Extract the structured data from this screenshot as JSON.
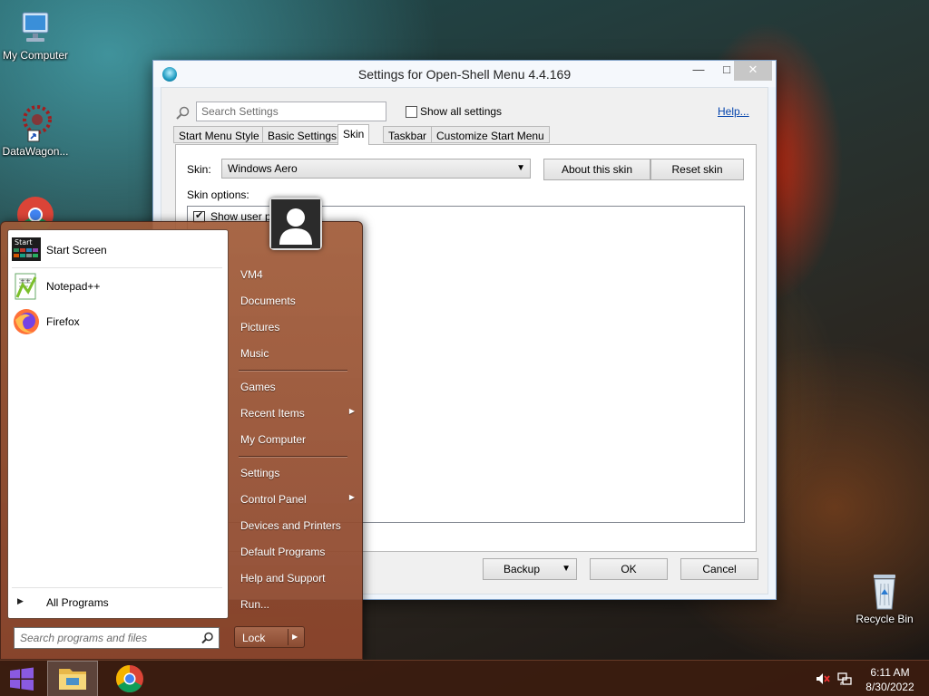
{
  "desktop": {
    "icons": [
      {
        "label": "My Computer"
      },
      {
        "label": "DataWagon..."
      },
      {
        "label": "Recycle Bin"
      }
    ]
  },
  "window": {
    "title": "Settings for Open-Shell Menu 4.4.169",
    "search_placeholder": "Search Settings",
    "show_all_label": "Show all settings",
    "help_label": "Help...",
    "tabs": [
      "Start Menu Style",
      "Basic Settings",
      "Skin",
      "Taskbar",
      "Customize Start Menu"
    ],
    "active_tab": "Skin",
    "skin_label": "Skin:",
    "skin_value": "Windows Aero",
    "about_skin_label": "About this skin",
    "reset_skin_label": "Reset skin",
    "skin_options_label": "Skin options:",
    "options": [
      {
        "label": "Show user pic",
        "checked": true
      }
    ],
    "backup_label": "Backup",
    "ok_label": "OK",
    "cancel_label": "Cancel"
  },
  "start_menu": {
    "programs": [
      {
        "label": "Start Screen",
        "icon": "start-screen-icon"
      },
      {
        "label": "Notepad++",
        "icon": "notepadpp-icon"
      },
      {
        "label": "Firefox",
        "icon": "firefox-icon"
      }
    ],
    "all_programs_label": "All Programs",
    "search_placeholder": "Search programs and files",
    "right_items": [
      {
        "label": "VM4"
      },
      {
        "label": "Documents"
      },
      {
        "label": "Pictures"
      },
      {
        "label": "Music"
      },
      {
        "label": "Games"
      },
      {
        "label": "Recent Items",
        "submenu": true
      },
      {
        "label": "My Computer"
      },
      {
        "label": "Settings"
      },
      {
        "label": "Control Panel",
        "submenu": true
      },
      {
        "label": "Devices and Printers"
      },
      {
        "label": "Default Programs"
      },
      {
        "label": "Help and Support"
      },
      {
        "label": "Run..."
      }
    ],
    "lock_label": "Lock"
  },
  "taskbar": {
    "time": "6:11 AM",
    "date": "8/30/2022"
  }
}
